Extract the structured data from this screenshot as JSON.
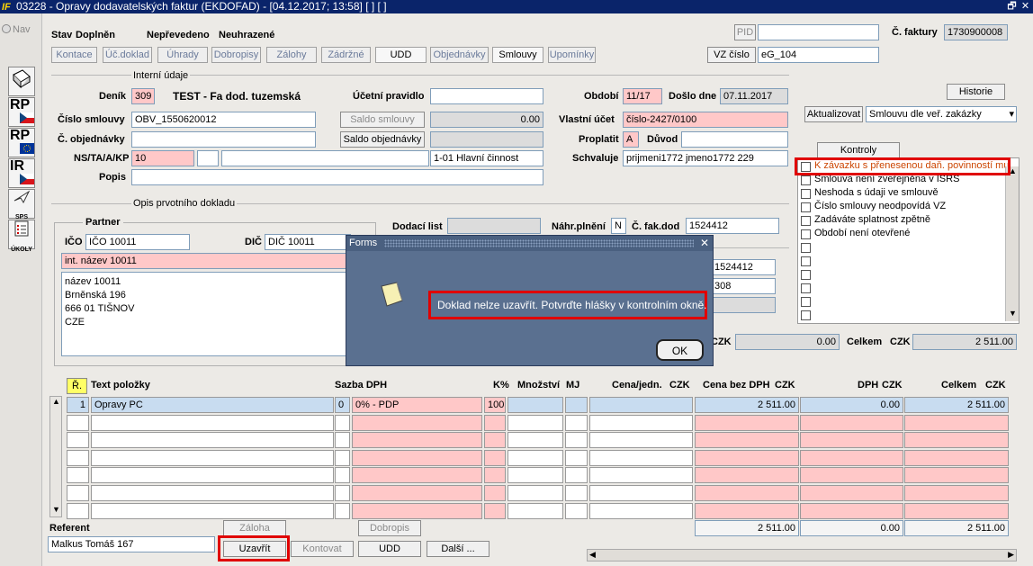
{
  "window": {
    "title": "03228 - Opravy dodavatelských faktur (EKDOFAD) - [04.12.2017; 13:58]  [ ]  [ ]",
    "logo": "IF",
    "restore": "🗗",
    "close": "✕"
  },
  "sidebar": {
    "nav": "Nav",
    "buttons": [
      "RP",
      "RP",
      "IR",
      "SPS",
      "ÚKOLY"
    ]
  },
  "header": {
    "stav_label": "Stav",
    "stav_value": "Doplněn",
    "stav2": "Nepřevedeno",
    "stav3": "Neuhrazené",
    "pid_label": "PID",
    "pid_value": "",
    "cislo_faktury_label": "Č. faktury",
    "cislo_faktury_value": "1730900008",
    "vz_button": "VZ číslo",
    "vz_value": "eG_104"
  },
  "tabs": [
    "Kontace",
    "Úč.doklad",
    "Úhrady",
    "Dobropisy",
    "Zálohy",
    "Zádržné",
    "UDD",
    "Objednávky",
    "Smlouvy",
    "Upomínky"
  ],
  "interni": {
    "section": "Interní údaje",
    "denik_label": "Deník",
    "denik_value": "309",
    "denik_name": "TEST - Fa dod. tuzemská",
    "ucetni_label": "Účetní pravidlo",
    "ucetni_value": "",
    "obdobi_label": "Období",
    "obdobi_value": "11/17",
    "doslo_label": "Došlo dne",
    "doslo_value": "07.11.2017",
    "historie": "Historie",
    "smlouvy_label": "Číslo smlouvy",
    "smlouvy_value": "OBV_1550620012",
    "saldo_smlouvy": "Saldo smlouvy",
    "saldo_smlouvy_value": "0.00",
    "vlastni_label": "Vlastní účet",
    "vlastni_value": "číslo-2427/0100",
    "aktualizovat": "Aktualizovat",
    "aktualizovat_select": "Smlouvu dle veř. zakázky",
    "objednavky_label": "Č. objednávky",
    "objednavky_value": "",
    "saldo_objednavky": "Saldo objednávky",
    "saldo_objednavky_value": "",
    "proplatit_label": "Proplatit",
    "proplatit_value": "A",
    "duvod_label": "Důvod",
    "duvod_value": "",
    "nsta_label": "NS/TA/A/KP",
    "nsta_value": "10",
    "nsta_2": "",
    "nsta_3": "",
    "nsta_4": "1-01 Hlavní činnost",
    "schvaluje_label": "Schvaluje",
    "schvaluje_value": "prijmeni1772 jmeno1772 229",
    "popis_label": "Popis",
    "popis_value": ""
  },
  "kontroly": {
    "button": "Kontroly",
    "items": [
      "K závazku s přenesenou daň. povinností mu",
      "Smlouva není zveřejněna v ISRS",
      "Neshoda s údaji ve smlouvě",
      "Číslo smlouvy neodpovídá VZ",
      "Zadáváte splatnost zpětně",
      "Období není otevřené",
      "",
      "",
      "",
      "",
      "",
      ""
    ]
  },
  "opis": {
    "section": "Opis prvotního dokladu",
    "partner_label": "Partner",
    "ico_label": "IČO",
    "ico_value": "IČO 10011",
    "dic_label": "DIČ",
    "dic_value": "DIČ 10011",
    "int_nazev": "int. název 10011",
    "address": [
      "název 10011",
      "Brněnská 196",
      "666 01 TIŠNOV",
      "CZE"
    ],
    "dodaci_label": "Dodací list",
    "dodaci_value": "",
    "nahr_label": "Náhr.plnění",
    "nahr_value": "N",
    "cfak_label": "Č. fak.dod",
    "cfak_value": "1524412",
    "vs_value": "1524412",
    "ks_value": "308",
    "czk_label": "CZK",
    "mid_total": "0.00",
    "celkem_label": "Celkem",
    "celkem_czk": "CZK",
    "celkem_value": "2 511.00"
  },
  "grid": {
    "r_button": "Ř.",
    "headers": {
      "text": "Text položky",
      "sazba": "Sazba DPH",
      "k": "K%",
      "mnozstvi": "Množství",
      "mj": "MJ",
      "cena": "Cena/jedn.",
      "cena_czk": "CZK",
      "bez": "Cena bez DPH",
      "bez_czk": "CZK",
      "dph": "DPH",
      "dph_czk": "CZK",
      "celkem": "Celkem",
      "celkem_czk": "CZK"
    },
    "rows": [
      {
        "r": "1",
        "text": "Opravy PC",
        "sazba": "0",
        "sazba_name": "0% - PDP",
        "k": "100",
        "mnozstvi": "",
        "mj": "",
        "cena": "",
        "bez": "2 511.00",
        "dph": "0.00",
        "celkem": "2 511.00"
      }
    ],
    "totals": {
      "bez": "2 511.00",
      "dph": "0.00",
      "celkem": "2 511.00"
    }
  },
  "footer": {
    "referent_label": "Referent",
    "referent_value": "Malkus Tomáš 167",
    "zaloha": "Záloha",
    "dobropis": "Dobropis",
    "uzavrit": "Uzavřít",
    "kontovat": "Kontovat",
    "udd": "UDD",
    "dalsi": "Další ..."
  },
  "dialog": {
    "title": "Forms",
    "close": "✕",
    "message": "Doklad nelze uzavřít. Potvrďte hlášky v kontrolním okně.",
    "ok": "OK"
  },
  "colors": {
    "title_bar": "#0a246a",
    "required": "#ffc8c8",
    "dialog": "#5a7090",
    "highlight": "#e00000",
    "selected_row": "#c8dcf0"
  }
}
